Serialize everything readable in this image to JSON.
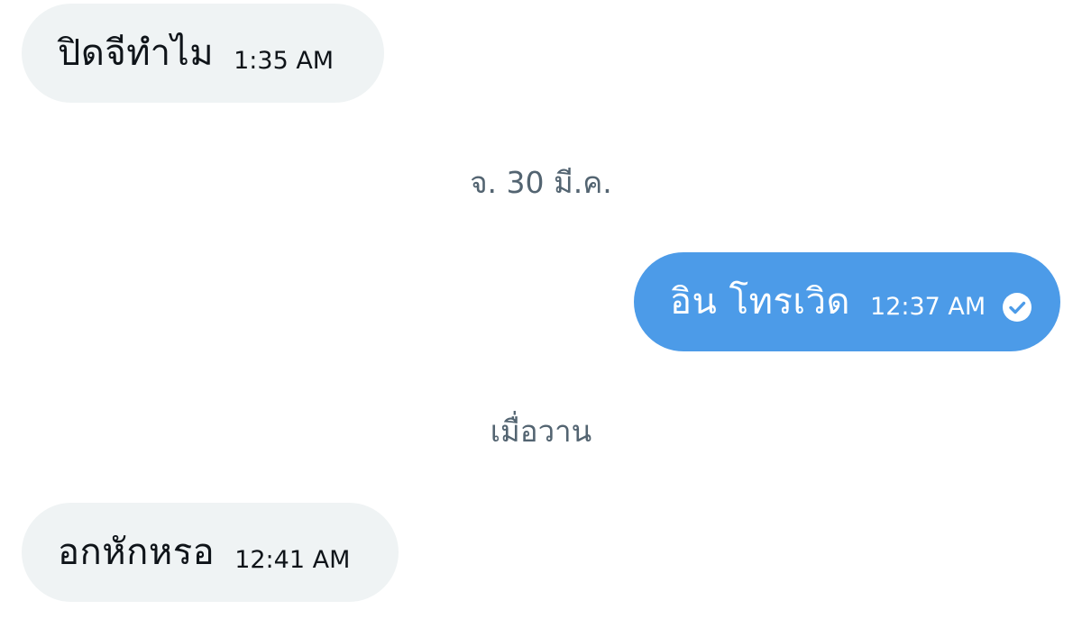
{
  "messages": [
    {
      "direction": "received",
      "text": "ปิดจีทำไม",
      "time": "1:35 AM"
    },
    {
      "direction": "sent",
      "text": "อิน โทรเวิด",
      "time": "12:37 AM",
      "status_icon": "read-check-icon"
    },
    {
      "direction": "received",
      "text": "อกหักหรอ",
      "time": "12:41 AM"
    }
  ],
  "separators": {
    "first": "จ. 30 มี.ค.",
    "second": "เมื่อวาน"
  },
  "colors": {
    "received_bubble": "#eff3f4",
    "sent_bubble": "#4c9be8",
    "separator_text": "#536471"
  }
}
